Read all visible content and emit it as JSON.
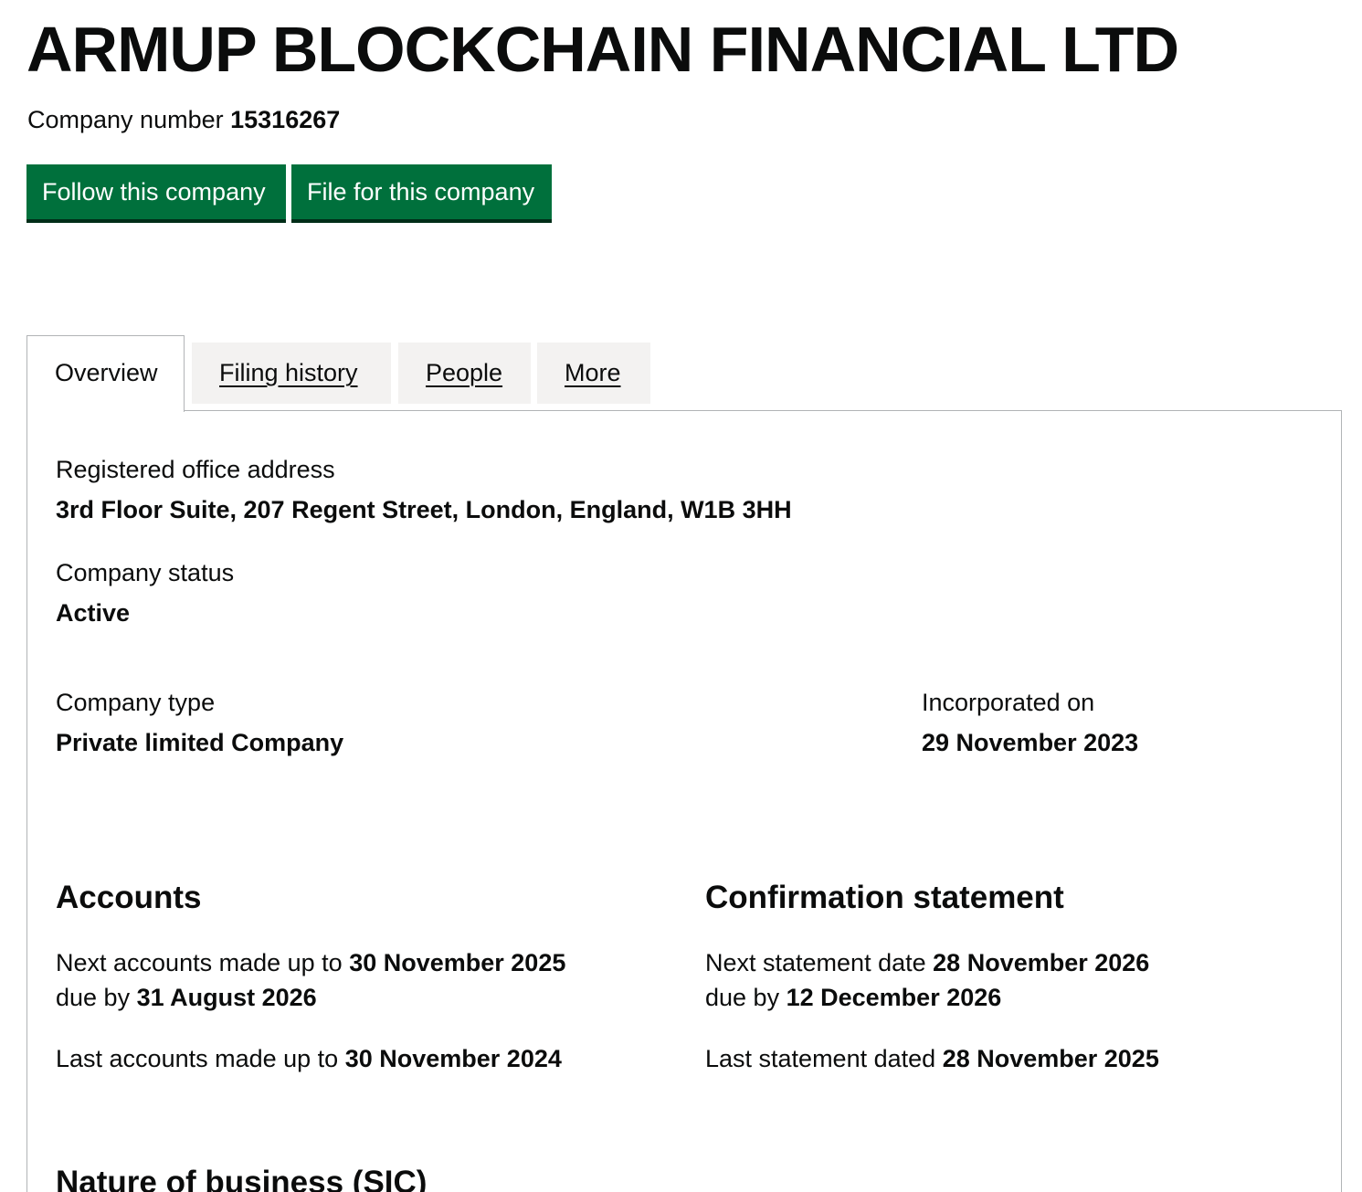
{
  "company": {
    "name": "ARMUP BLOCKCHAIN FINANCIAL LTD",
    "number_label": "Company number",
    "number": "15316267"
  },
  "actions": {
    "follow_label": "Follow this company",
    "file_label": "File for this company"
  },
  "tabs": [
    {
      "label": "Overview",
      "active": true
    },
    {
      "label": "Filing history",
      "active": false
    },
    {
      "label": "People",
      "active": false
    },
    {
      "label": "More",
      "active": false
    }
  ],
  "overview": {
    "registered_office": {
      "label": "Registered office address",
      "value": "3rd Floor Suite, 207 Regent Street, London, England, W1B 3HH"
    },
    "status": {
      "label": "Company status",
      "value": "Active"
    },
    "type": {
      "label": "Company type",
      "value": "Private limited Company"
    },
    "incorporated": {
      "label": "Incorporated on",
      "value": "29 November 2023"
    }
  },
  "accounts": {
    "heading": "Accounts",
    "next_label": "Next accounts made up to",
    "next_date": "30 November 2025",
    "due_label": "due by",
    "due_date": "31 August 2026",
    "last_label": "Last accounts made up to",
    "last_date": "30 November 2024"
  },
  "confirmation": {
    "heading": "Confirmation statement",
    "next_label": "Next statement date",
    "next_date": "28 November 2026",
    "due_label": "due by",
    "due_date": "12 December 2026",
    "last_label": "Last statement dated",
    "last_date": "28 November 2025"
  },
  "nature": {
    "heading": "Nature of business (SIC)"
  },
  "colors": {
    "button_green": "#00703c",
    "button_shadow": "#002d18",
    "tab_inactive_bg": "#f3f2f1",
    "border": "#b1b4b6",
    "text": "#0b0c0c"
  }
}
